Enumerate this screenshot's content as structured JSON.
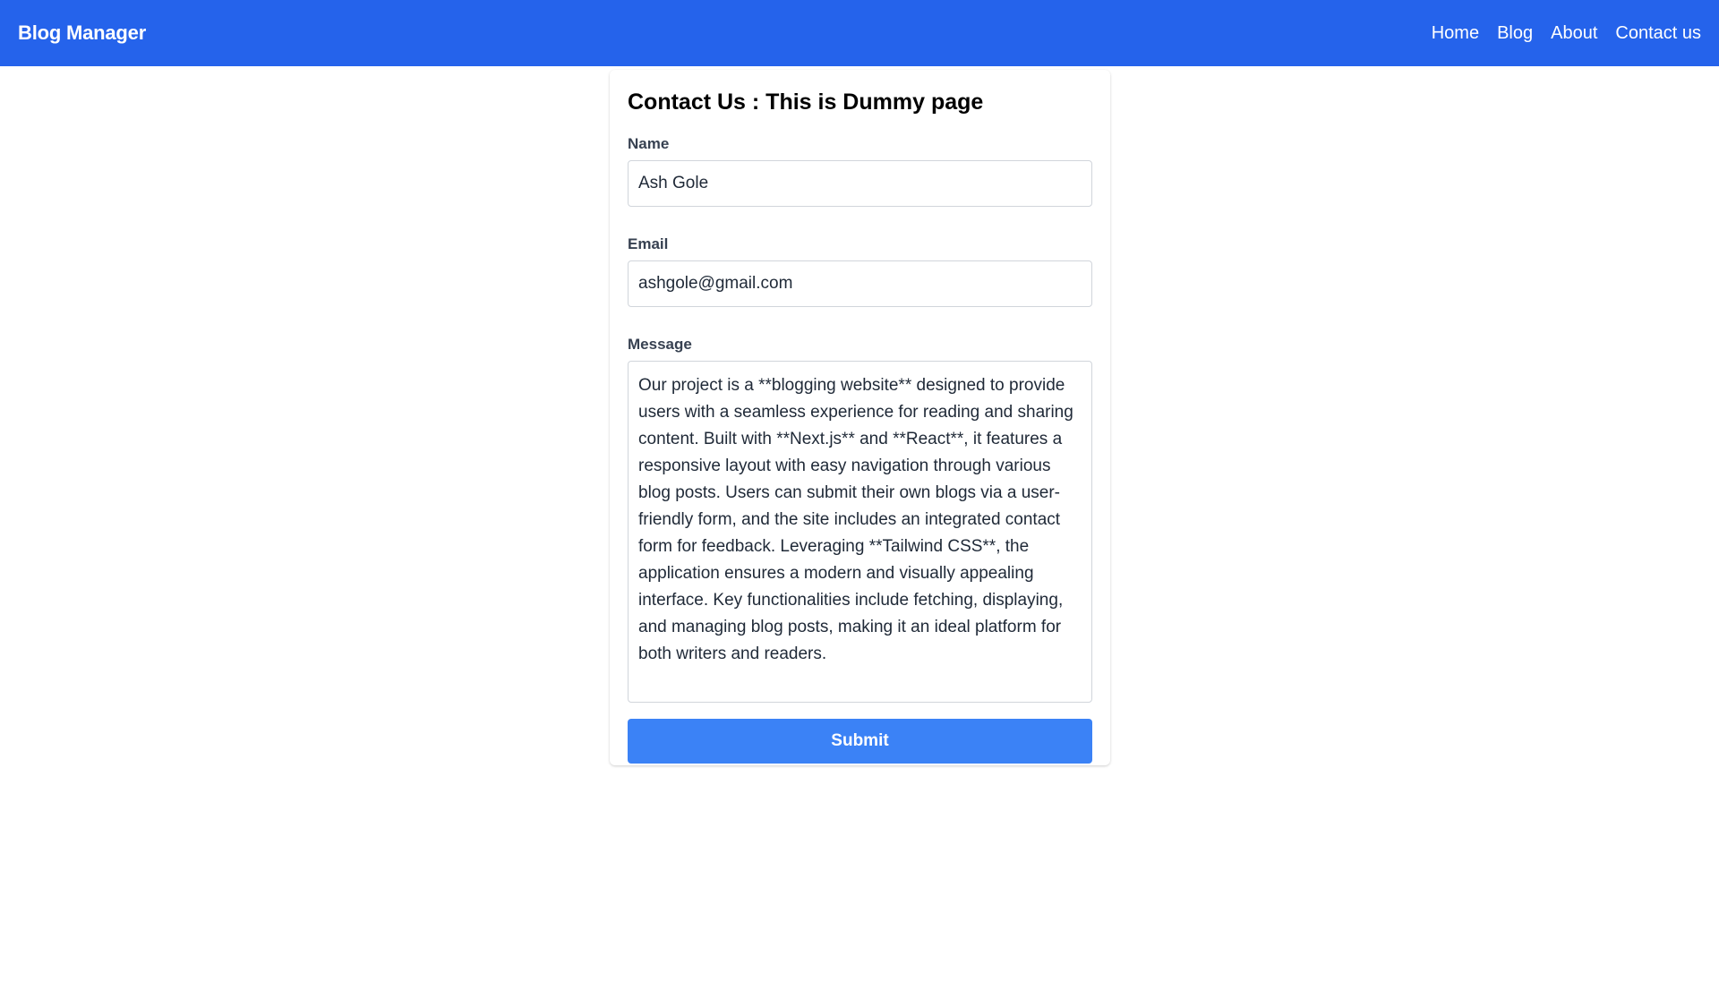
{
  "navbar": {
    "brand": "Blog Manager",
    "links": [
      {
        "label": "Home"
      },
      {
        "label": "Blog"
      },
      {
        "label": "About"
      },
      {
        "label": "Contact us"
      }
    ]
  },
  "form": {
    "title": "Contact Us : This is Dummy page",
    "name": {
      "label": "Name",
      "value": "Ash Gole"
    },
    "email": {
      "label": "Email",
      "value": "ashgole@gmail.com"
    },
    "message": {
      "label": "Message",
      "value": "Our project is a **blogging website** designed to provide users with a seamless experience for reading and sharing content. Built with **Next.js** and **React**, it features a responsive layout with easy navigation through various blog posts. Users can submit their own blogs via a user-friendly form, and the site includes an integrated contact form for feedback. Leveraging **Tailwind CSS**, the application ensures a modern and visually appealing interface. Key functionalities include fetching, displaying, and managing blog posts, making it an ideal platform for both writers and readers."
    },
    "submit_label": "Submit"
  },
  "colors": {
    "navbar_bg": "#2563eb",
    "button_bg": "#3b82f6"
  }
}
